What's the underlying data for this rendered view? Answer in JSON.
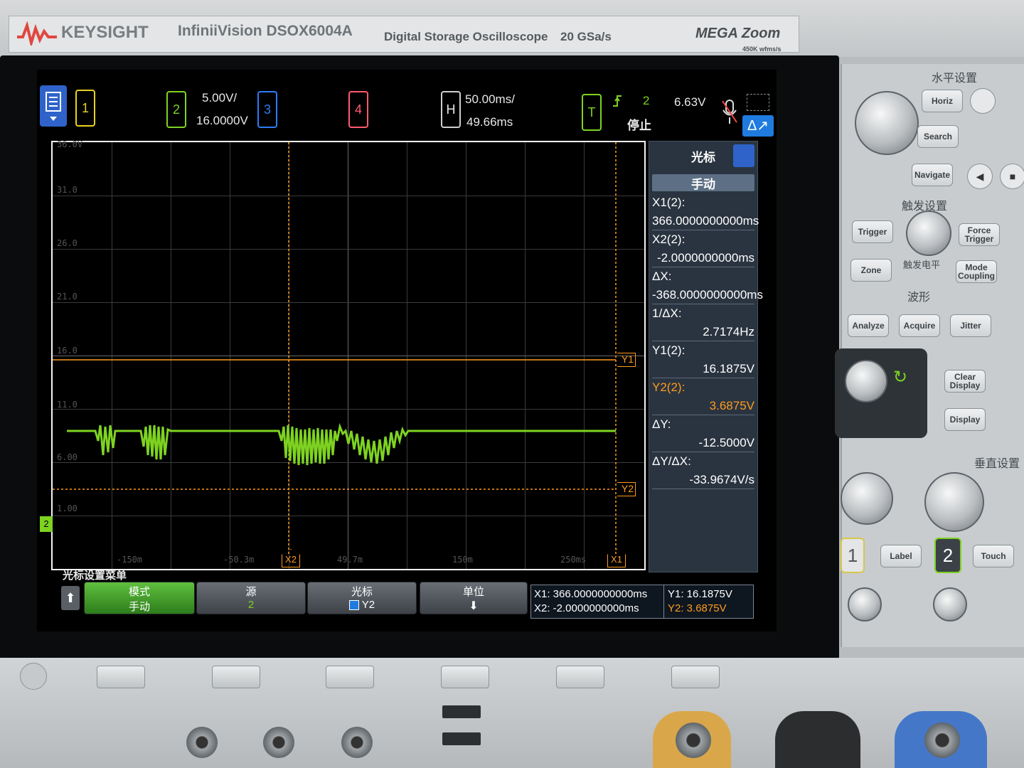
{
  "header": {
    "brand": "KEYSIGHT",
    "model": "InfiniiVision DSOX6004A",
    "description": "Digital Storage Oscilloscope",
    "rate": "20 GSa/s",
    "zoom_logo": "MEGA Zoom",
    "zoom_sub": "450K wfms/s"
  },
  "status": {
    "ch1": "1",
    "ch2": "2",
    "ch2_scale": "5.00V/",
    "ch2_offset": "16.0000V",
    "ch3": "3",
    "ch4": "4",
    "h_label": "H",
    "time_scale": "50.00ms/",
    "time_delay": "49.66ms",
    "t_label": "T",
    "trig_source": "2",
    "trig_state": "停止",
    "trig_level": "6.63V"
  },
  "grid": {
    "y_labels": [
      "36.0V",
      "31.0",
      "26.0",
      "21.0",
      "16.0",
      "11.0",
      "6.00",
      "1.00"
    ],
    "x_labels": [
      "-150m",
      "-50.3m",
      "49.7m",
      "150m",
      "250ms"
    ]
  },
  "markers": {
    "y1": "Y1",
    "y2": "Y2",
    "x1": "X1",
    "x2": "X2",
    "ch_marker": "2"
  },
  "cursor_panel": {
    "title": "光标",
    "mode": "手动",
    "x1_label": "X1(2):",
    "x1_value": "366.0000000000ms",
    "x2_label": "X2(2):",
    "x2_value": "-2.0000000000ms",
    "dx_label": "ΔX:",
    "dx_value": "-368.0000000000ms",
    "inv_dx_label": "1/ΔX:",
    "inv_dx_value": "2.7174Hz",
    "y1_label": "Y1(2):",
    "y1_value": "16.1875V",
    "y2_label": "Y2(2):",
    "y2_value": "3.6875V",
    "dy_label": "ΔY:",
    "dy_value": "-12.5000V",
    "dydx_label": "ΔY/ΔX:",
    "dydx_value": "-33.9674V/s"
  },
  "softkeys": {
    "menu_title": "光标设置菜单",
    "mode_top": "模式",
    "mode_bottom": "手动",
    "source_top": "源",
    "source_bottom": "2",
    "cursor_top": "光标",
    "cursor_bottom": "Y2",
    "unit_top": "单位"
  },
  "readout": {
    "x1": "X1: 366.0000000000ms",
    "x2": "X2: -2.0000000000ms",
    "y1": "Y1: 16.1875V",
    "y2": "Y2: 3.6875V"
  },
  "panel": {
    "horizontal": "水平设置",
    "horiz_btn": "Horiz",
    "search_btn": "Search",
    "navigate_btn": "Navigate",
    "trigger_section": "触发设置",
    "trigger_btn": "Trigger",
    "force_btn": "Force Trigger",
    "zone_btn": "Zone",
    "trig_level_label": "触发电平",
    "mode_btn": "Mode Coupling",
    "waveform_section": "波形",
    "analyze_btn": "Analyze",
    "acquire_btn": "Acquire",
    "jitter_btn": "Jitter",
    "clear_btn": "Clear Display",
    "display_btn": "Display",
    "vertical_section": "垂直设置",
    "label_btn": "Label",
    "touch_btn": "Touch",
    "ch1_num": "1",
    "ch2_num": "2"
  },
  "colors": {
    "ch1": "#e8d21f",
    "ch2": "#7ed321",
    "ch3": "#2f7cf6",
    "ch4": "#ff5a6e",
    "cursor": "#ff9b1f"
  }
}
